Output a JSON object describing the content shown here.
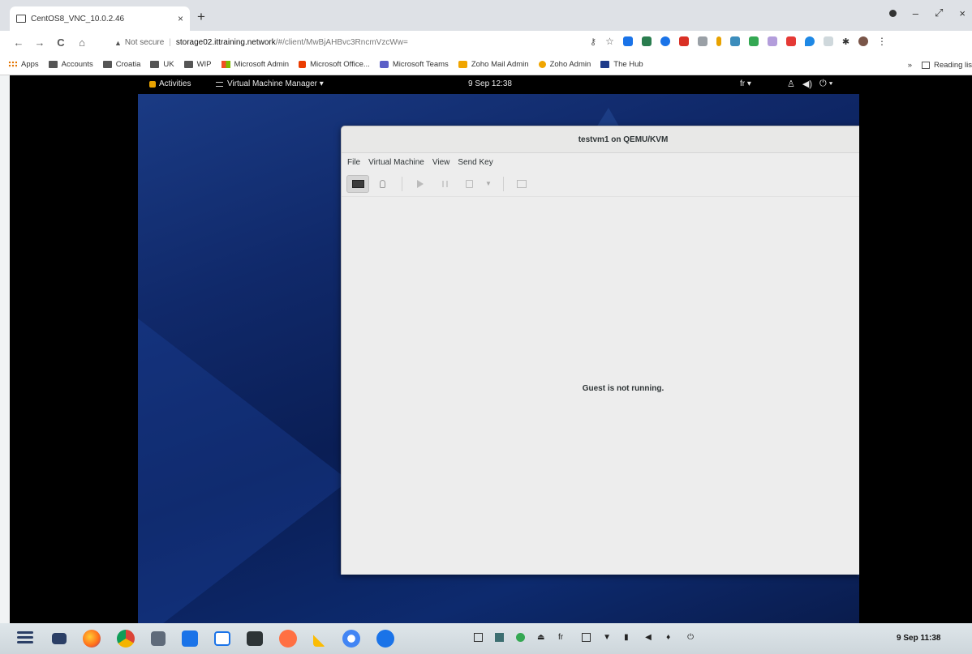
{
  "browser": {
    "tab_title": "CentOS8_VNC_10.0.2.46",
    "tab_close": "×",
    "new_tab": "+",
    "window_minimize": "–",
    "window_restore": "⤢",
    "window_close": "×",
    "nav_back": "←",
    "nav_forward": "→",
    "nav_reload": "C",
    "nav_home": "⌂",
    "security_warning": "Not secure",
    "url_host": "storage02.ittraining.network",
    "url_path": "/#/client/MwBjAHBvc3RncmVzcWw=",
    "bookmarks": [
      {
        "label": "Apps",
        "icon": "apps-grid-icon"
      },
      {
        "label": "Accounts",
        "icon": "folder-icon"
      },
      {
        "label": "Croatia",
        "icon": "folder-icon"
      },
      {
        "label": "UK",
        "icon": "folder-icon"
      },
      {
        "label": "WIP",
        "icon": "folder-icon"
      },
      {
        "label": "Microsoft Admin",
        "icon": "microsoft-icon"
      },
      {
        "label": "Microsoft Office...",
        "icon": "office-icon"
      },
      {
        "label": "Microsoft Teams",
        "icon": "teams-icon"
      },
      {
        "label": "Zoho Mail Admin",
        "icon": "zoho-mail-icon"
      },
      {
        "label": "Zoho Admin",
        "icon": "zoho-admin-icon"
      },
      {
        "label": "The Hub",
        "icon": "hub-icon"
      }
    ],
    "bookmarks_more": "»",
    "reading_list": "Reading lis"
  },
  "gnome": {
    "activities": "Activities",
    "app_menu": "Virtual Machine Manager ▾",
    "clock": "9 Sep 12:38",
    "input_source": "fr ▾",
    "tray": [
      "♙",
      "◀)",
      "⏻ ▾"
    ]
  },
  "vm_window": {
    "title": "testvm1 on QEMU/KVM",
    "close": "×",
    "menus": [
      "File",
      "Virtual Machine",
      "View",
      "Send Key"
    ],
    "message": "Guest is not running."
  },
  "shelf": {
    "clock": "9 Sep 11:38",
    "lang": "fr"
  }
}
